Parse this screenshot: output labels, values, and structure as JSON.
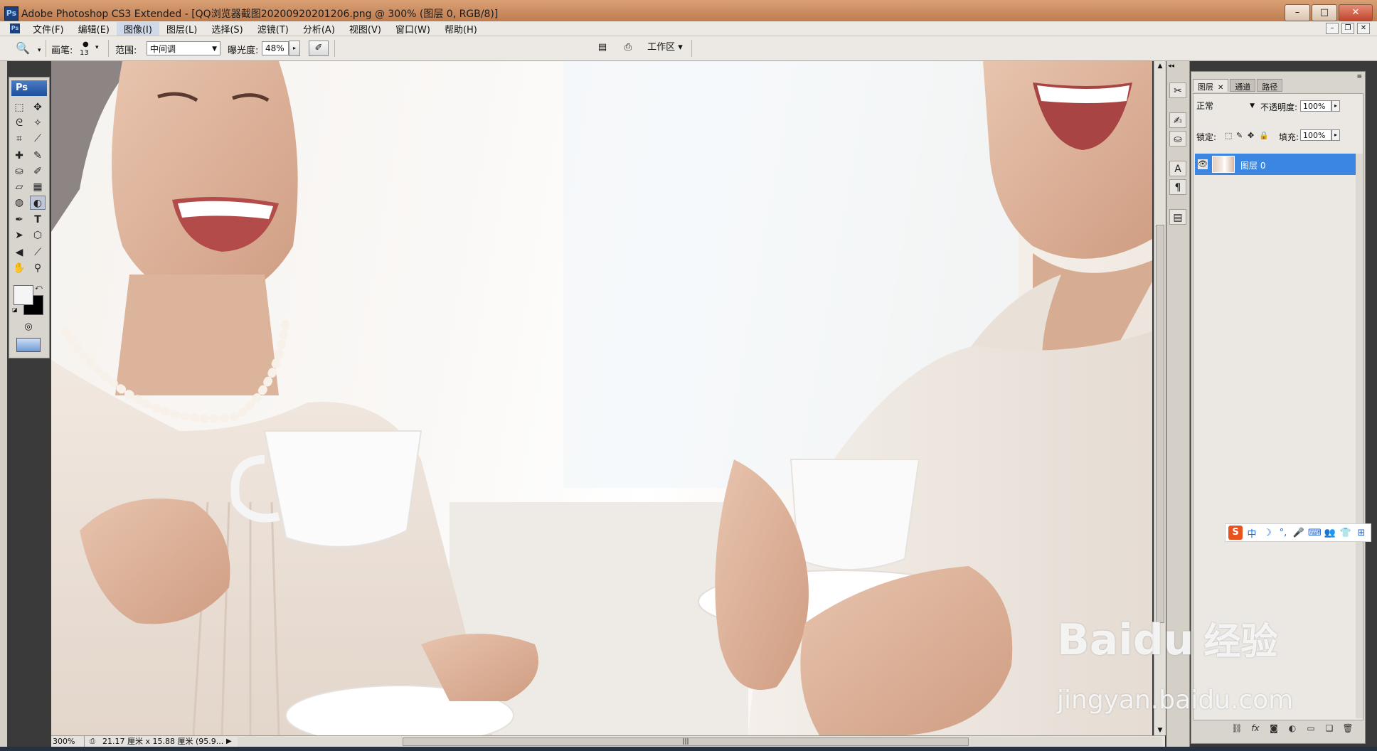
{
  "window": {
    "title": "Adobe Photoshop CS3 Extended - [QQ浏览器截图20200920201206.png @ 300% (图层 0, RGB/8)]",
    "icon_label": "Ps",
    "buttons": {
      "minimize": "–",
      "maximize": "□",
      "close": "✕"
    }
  },
  "menu": {
    "icon_label": "Ps",
    "items": [
      "文件(F)",
      "编辑(E)",
      "图像(I)",
      "图层(L)",
      "选择(S)",
      "滤镜(T)",
      "分析(A)",
      "视图(V)",
      "窗口(W)",
      "帮助(H)"
    ],
    "active_index": 2,
    "doc_buttons": {
      "minimize": "–",
      "restore": "❐",
      "close": "✕"
    }
  },
  "options": {
    "tool_icon": "🔍",
    "brush_label": "画笔:",
    "brush_size": "13",
    "range_label": "范围:",
    "range_value": "中间调",
    "exposure_label": "曝光度:",
    "exposure_value": "48%",
    "workspace_label": "工作区 ▾"
  },
  "toolbox": {
    "logo": "Ps",
    "tools": [
      {
        "name": "marquee-icon",
        "glyph": "⬚"
      },
      {
        "name": "move-icon",
        "glyph": "✥"
      },
      {
        "name": "lasso-icon",
        "glyph": "ᘓ"
      },
      {
        "name": "magic-wand-icon",
        "glyph": "✧"
      },
      {
        "name": "crop-icon",
        "glyph": "⌗"
      },
      {
        "name": "slice-icon",
        "glyph": "⟋"
      },
      {
        "name": "healing-icon",
        "glyph": "✚"
      },
      {
        "name": "brush-icon",
        "glyph": "✎"
      },
      {
        "name": "stamp-icon",
        "glyph": "⛀"
      },
      {
        "name": "history-brush-icon",
        "glyph": "✐"
      },
      {
        "name": "eraser-icon",
        "glyph": "▱"
      },
      {
        "name": "gradient-icon",
        "glyph": "▦"
      },
      {
        "name": "blur-icon",
        "glyph": "◍"
      },
      {
        "name": "dodge-icon",
        "glyph": "◐"
      },
      {
        "name": "pen-icon",
        "glyph": "✒"
      },
      {
        "name": "type-icon",
        "glyph": "T"
      },
      {
        "name": "path-select-icon",
        "glyph": "➤"
      },
      {
        "name": "shape-icon",
        "glyph": "⬡"
      },
      {
        "name": "notes-icon",
        "glyph": "◀"
      },
      {
        "name": "eyedropper-icon",
        "glyph": "⟋"
      },
      {
        "name": "hand-icon",
        "glyph": "✋"
      },
      {
        "name": "zoom-icon",
        "glyph": "⚲"
      }
    ]
  },
  "status": {
    "zoom": "300%",
    "doc_info": "21.17 厘米 x 15.88 厘米 (95.9...",
    "play": "▶"
  },
  "layers_panel": {
    "tabs": [
      "图层",
      "通道",
      "路径"
    ],
    "tab_close": "✕",
    "blend_mode": "正常",
    "opacity_label": "不透明度:",
    "opacity_value": "100%",
    "lock_label": "锁定:",
    "fill_label": "填充:",
    "fill_value": "100%",
    "layer_name": "图层 0"
  },
  "ime": {
    "logo": "S",
    "items": [
      "中",
      "☽",
      "°,",
      "🎤",
      "⌨",
      "👥",
      "👕",
      "⊞"
    ]
  },
  "watermark": {
    "brand": "Baidu",
    "brand_cn": "经验",
    "url": "jingyan.baidu.com"
  }
}
